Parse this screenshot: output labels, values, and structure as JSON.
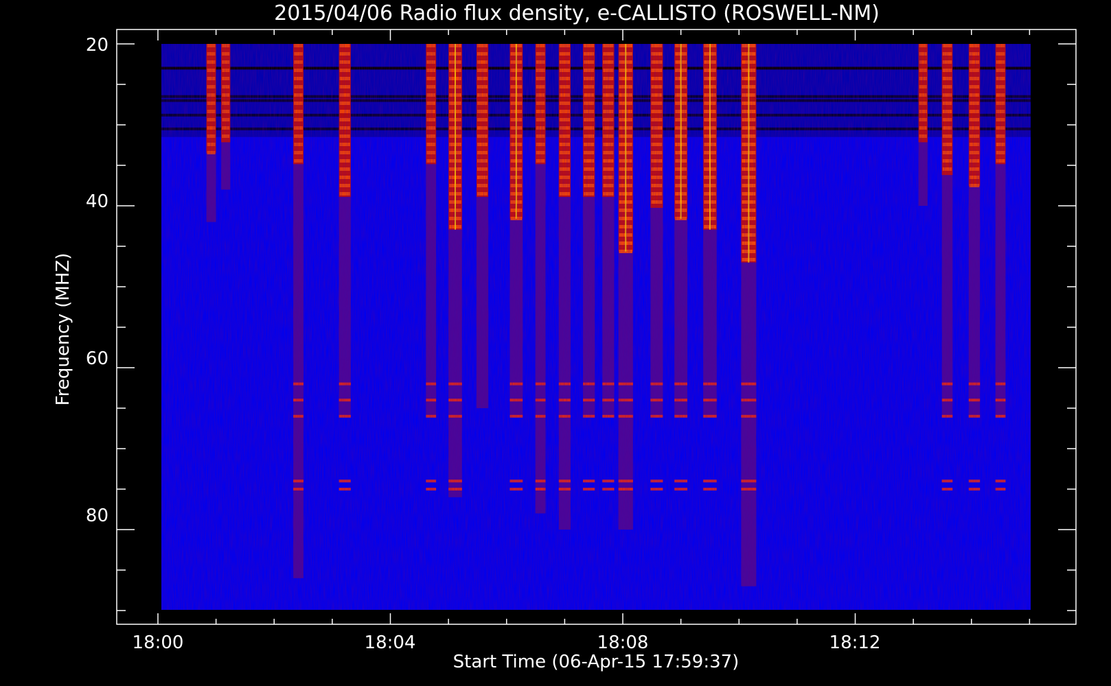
{
  "chart_data": {
    "type": "heatmap",
    "title": "2015/04/06  Radio flux density, e-CALLISTO (ROSWELL-NM)",
    "xlabel": "Start Time (06-Apr-15 17:59:37)",
    "ylabel": "Frequency (MHZ)",
    "x_ticks": [
      "18:00",
      "18:04",
      "18:08",
      "18:12"
    ],
    "y_ticks": [
      "20",
      "40",
      "60",
      "80"
    ],
    "xlim_minutes_after_1800": [
      -0.75,
      15.75
    ],
    "ylim_mhz": [
      20,
      92
    ],
    "y_inverted": true,
    "colormap": "black-blue-red-yellow-white",
    "background_color": "#0000ee",
    "band_color": "#cc1100",
    "hot_color": "#ffd000",
    "interference_rows_mhz": [
      23,
      26.5,
      27,
      28.8,
      30.5
    ],
    "bursts": [
      {
        "time": "18:00:55",
        "f_low_mhz": 20,
        "f_high_mhz": 42,
        "intensity": 0.5
      },
      {
        "time": "18:01:10",
        "f_low_mhz": 20,
        "f_high_mhz": 38,
        "intensity": 0.45
      },
      {
        "time": "18:02:25",
        "f_low_mhz": 20,
        "f_high_mhz": 86,
        "intensity": 0.55
      },
      {
        "time": "18:03:13",
        "f_low_mhz": 20,
        "f_high_mhz": 66,
        "intensity": 0.7
      },
      {
        "time": "18:04:42",
        "f_low_mhz": 20,
        "f_high_mhz": 66,
        "intensity": 0.55
      },
      {
        "time": "18:05:07",
        "f_low_mhz": 20,
        "f_high_mhz": 76,
        "intensity": 0.85
      },
      {
        "time": "18:05:35",
        "f_low_mhz": 20,
        "f_high_mhz": 65,
        "intensity": 0.7
      },
      {
        "time": "18:06:10",
        "f_low_mhz": 20,
        "f_high_mhz": 66,
        "intensity": 0.8
      },
      {
        "time": "18:06:35",
        "f_low_mhz": 20,
        "f_high_mhz": 78,
        "intensity": 0.55
      },
      {
        "time": "18:07:00",
        "f_low_mhz": 20,
        "f_high_mhz": 80,
        "intensity": 0.7
      },
      {
        "time": "18:07:25",
        "f_low_mhz": 20,
        "f_high_mhz": 66,
        "intensity": 0.7
      },
      {
        "time": "18:07:45",
        "f_low_mhz": 20,
        "f_high_mhz": 66,
        "intensity": 0.7
      },
      {
        "time": "18:08:03",
        "f_low_mhz": 20,
        "f_high_mhz": 80,
        "intensity": 0.95
      },
      {
        "time": "18:08:35",
        "f_low_mhz": 20,
        "f_high_mhz": 66,
        "intensity": 0.75
      },
      {
        "time": "18:09:00",
        "f_low_mhz": 20,
        "f_high_mhz": 66,
        "intensity": 0.8
      },
      {
        "time": "18:09:30",
        "f_low_mhz": 20,
        "f_high_mhz": 66,
        "intensity": 0.85
      },
      {
        "time": "18:10:10",
        "f_low_mhz": 20,
        "f_high_mhz": 87,
        "intensity": 1.0
      },
      {
        "time": "18:13:10",
        "f_low_mhz": 20,
        "f_high_mhz": 40,
        "intensity": 0.45
      },
      {
        "time": "18:13:35",
        "f_low_mhz": 20,
        "f_high_mhz": 66,
        "intensity": 0.6
      },
      {
        "time": "18:14:03",
        "f_low_mhz": 20,
        "f_high_mhz": 66,
        "intensity": 0.65
      },
      {
        "time": "18:14:30",
        "f_low_mhz": 20,
        "f_high_mhz": 66,
        "intensity": 0.55
      }
    ]
  }
}
